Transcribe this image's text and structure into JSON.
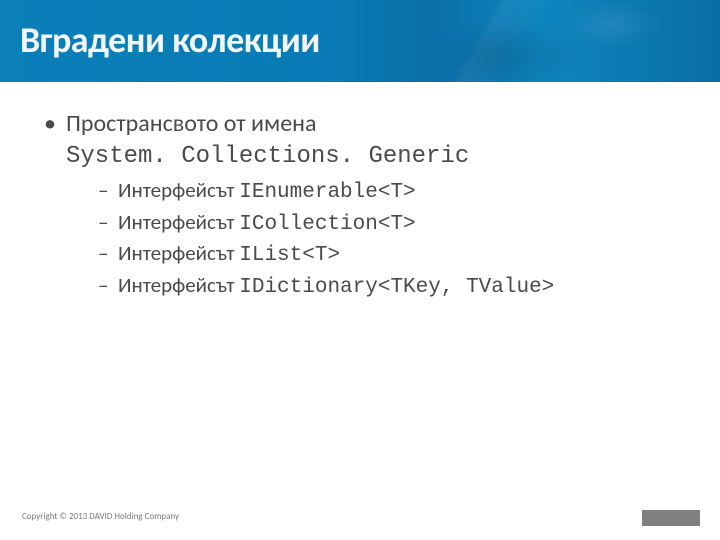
{
  "title": "Вградени колекции",
  "main": {
    "line1": "Пространсвото от имена",
    "line2_code": "System. Collections. Generic",
    "items": [
      {
        "label": "Интерфейсът ",
        "code": "IEnumerable<T>"
      },
      {
        "label": "Интерфейсът ",
        "code": "ICollection<T>"
      },
      {
        "label": "Интерфейсът ",
        "code": "IList<T>"
      },
      {
        "label": "Интерфейсът ",
        "code": "IDictionary<TKey, TValue>"
      }
    ]
  },
  "footer": "Copyright © 2013 DAVID Holding Company",
  "colors": {
    "banner_start": "#0a7fb8",
    "banner_end": "#0a6ea5",
    "text": "#4a4a4a"
  }
}
